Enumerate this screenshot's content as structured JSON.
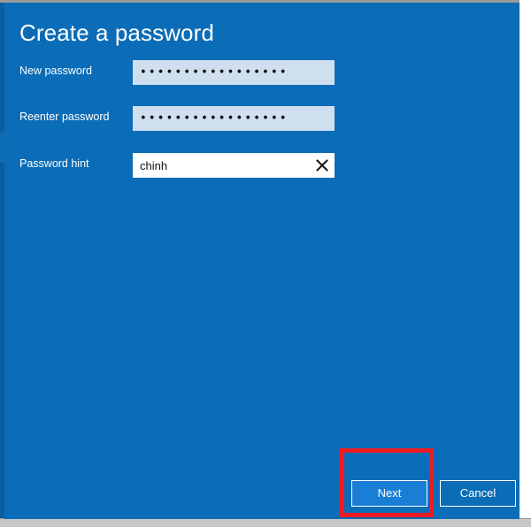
{
  "dialog": {
    "title": "Create a password",
    "background_color": "#0b6cb7",
    "fields": [
      {
        "id": "new-password",
        "label": "New password",
        "type": "password",
        "value": "•••••••••••••••••",
        "placeholder": "",
        "focused": false,
        "field_background": "#cfdff0"
      },
      {
        "id": "reenter-password",
        "label": "Reenter password",
        "type": "password",
        "value": "•••••••••••••••••",
        "placeholder": "",
        "focused": false,
        "field_background": "#cfdff0"
      },
      {
        "id": "password-hint",
        "label": "Password hint",
        "type": "text",
        "value": "chinh",
        "placeholder": "",
        "focused": true,
        "field_background": "#ffffff",
        "clear_icon": "close-x-icon"
      }
    ],
    "buttons": {
      "next": {
        "label": "Next",
        "primary": true,
        "fill_color": "#1b7ed6",
        "border_color": "#ffffff"
      },
      "cancel": {
        "label": "Cancel",
        "primary": false,
        "fill_color": "transparent",
        "border_color": "#ffffff"
      }
    }
  },
  "annotation": {
    "target": "next-button",
    "shape": "rectangle",
    "color": "#ed1c24",
    "stroke_width": 5
  }
}
